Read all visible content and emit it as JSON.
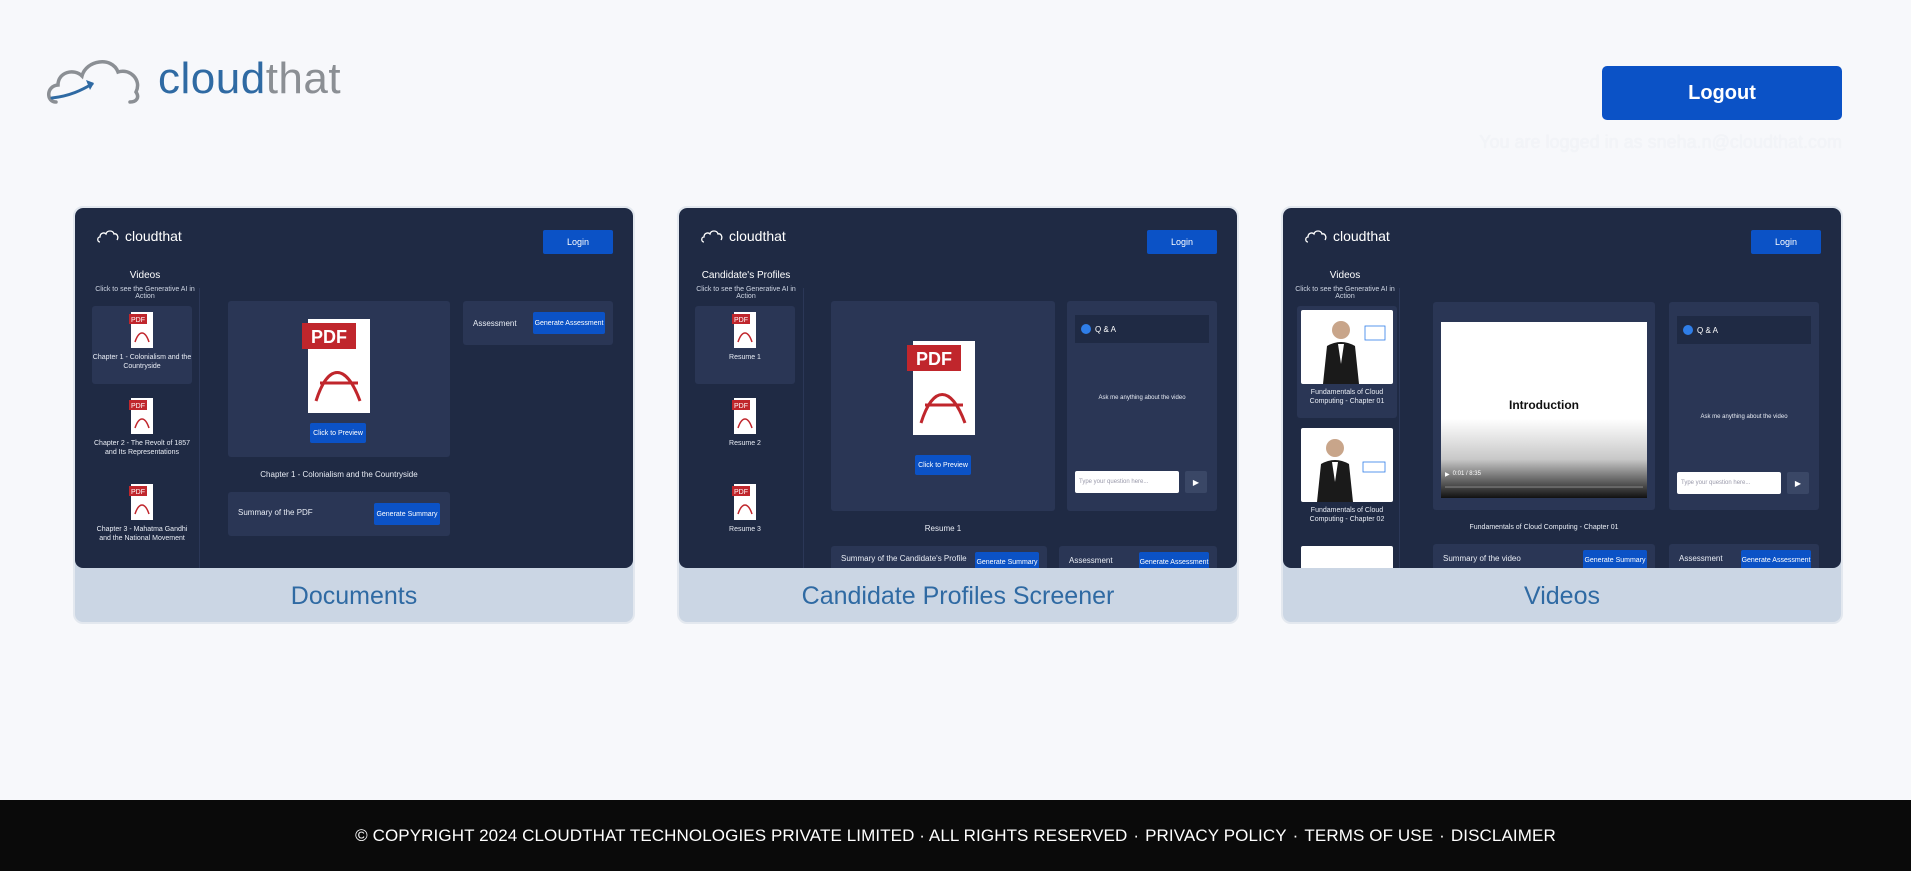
{
  "header": {
    "logo_text_a": "cloud",
    "logo_text_b": "that",
    "logout_label": "Logout",
    "logged_in_text": "You are logged in as sneha.n@cloudthat.com"
  },
  "cards": [
    {
      "title": "Documents",
      "preview": {
        "logo": "cloudthat",
        "login": "Login",
        "side_title": "Videos",
        "side_sub": "Click to see the Generative AI in Action",
        "items": [
          "Chapter 1 - Colonialism and the Countryside",
          "Chapter 2 - The Revolt of 1857 and Its Representations",
          "Chapter 3 - Mahatma Gandhi and the National Movement"
        ],
        "preview_button": "Click to Preview",
        "doc_caption": "Chapter 1 - Colonialism and the Countryside",
        "summary_label": "Summary of the PDF",
        "summary_button": "Generate Summary",
        "assessment_label": "Assessment",
        "assessment_button": "Generate Assessment"
      }
    },
    {
      "title": "Candidate Profiles Screener",
      "preview": {
        "logo": "cloudthat",
        "login": "Login",
        "side_title": "Candidate's Profiles",
        "side_sub": "Click to see the Generative AI in Action",
        "items": [
          "Resume 1",
          "Resume 2",
          "Resume 3"
        ],
        "preview_button": "Click to Preview",
        "doc_caption": "Resume 1",
        "qa_title": "Q & A",
        "qa_hint": "Ask me anything about the video",
        "qa_placeholder": "Type your question here...",
        "summary_label": "Summary of the Candidate's Profile",
        "summary_button": "Generate Summary",
        "assessment_label": "Assessment",
        "assessment_button": "Generate Assessment"
      }
    },
    {
      "title": "Videos",
      "preview": {
        "logo": "cloudthat",
        "login": "Login",
        "side_title": "Videos",
        "side_sub": "Click to see the Generative AI in Action",
        "items": [
          "Fundamentals of Cloud Computing - Chapter 01",
          "Fundamentals of Cloud Computing - Chapter 02"
        ],
        "video_title": "Introduction",
        "video_time": "0:01 / 8:35",
        "video_caption": "Fundamentals of Cloud Computing - Chapter 01",
        "qa_title": "Q & A",
        "qa_hint": "Ask me anything about the video",
        "qa_placeholder": "Type your question here...",
        "summary_label": "Summary of the video",
        "summary_button": "Generate Summary",
        "assessment_label": "Assessment",
        "assessment_button": "Generate Assessment"
      }
    }
  ],
  "footer": {
    "copyright": "© COPYRIGHT 2024 CLOUDTHAT TECHNOLOGIES PRIVATE LIMITED · ALL RIGHTS RESERVED",
    "privacy": "PRIVACY POLICY",
    "terms": "TERMS OF USE",
    "disclaimer": "DISCLAIMER",
    "separator": "·"
  },
  "colors": {
    "brand_blue": "#0b52c6",
    "logo_blue": "#2f6aa3",
    "preview_bg": "#1f2a44",
    "card_footer": "#cbd6e4"
  },
  "icons": [
    "cloud-logo-icon",
    "pdf-icon",
    "chat-bubble-icon",
    "send-icon",
    "play-icon"
  ]
}
